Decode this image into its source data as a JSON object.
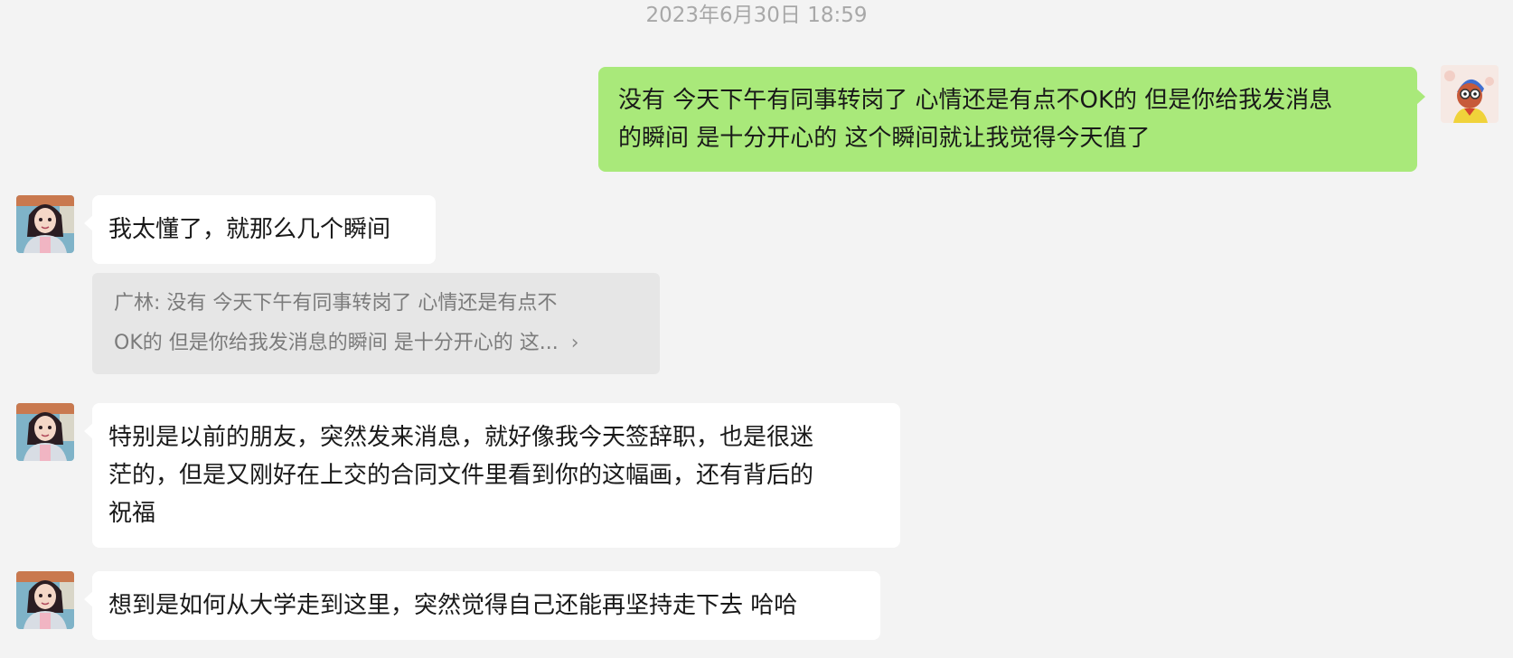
{
  "chat": {
    "timestamp": "2023年6月30日 18:59",
    "messages": [
      {
        "side": "out",
        "lines": [
          "没有 今天下午有同事转岗了 心情还是有点不OK的 但是你给我发消息",
          "的瞬间 是十分开心的 这个瞬间就让我觉得今天值了"
        ]
      },
      {
        "side": "in",
        "lines": [
          "我太懂了，就那么几个瞬间"
        ],
        "quote": {
          "lines": [
            "广林: 没有 今天下午有同事转岗了 心情还是有点不",
            "OK的 但是你给我发消息的瞬间 是十分开心的 这..."
          ],
          "chevron": "›"
        }
      },
      {
        "side": "in",
        "lines": [
          "特别是以前的朋友，突然发来消息，就好像我今天签辞职，也是很迷",
          "茫的，但是又刚好在上交的合同文件里看到你的这幅画，还有背后的",
          "祝福"
        ]
      },
      {
        "side": "in",
        "lines": [
          "想到是如何从大学走到这里，突然觉得自己还能再坚持走下去 哈哈"
        ]
      }
    ]
  },
  "colors": {
    "background": "#f3f3f3",
    "outgoing_bubble": "#a9e97a",
    "incoming_bubble": "#ffffff",
    "quote_bubble": "#e6e6e6",
    "timestamp_text": "#a8a8a8"
  },
  "avatars": {
    "self": "cartoon-character-avatar",
    "contact": "anime-girl-avatar"
  }
}
